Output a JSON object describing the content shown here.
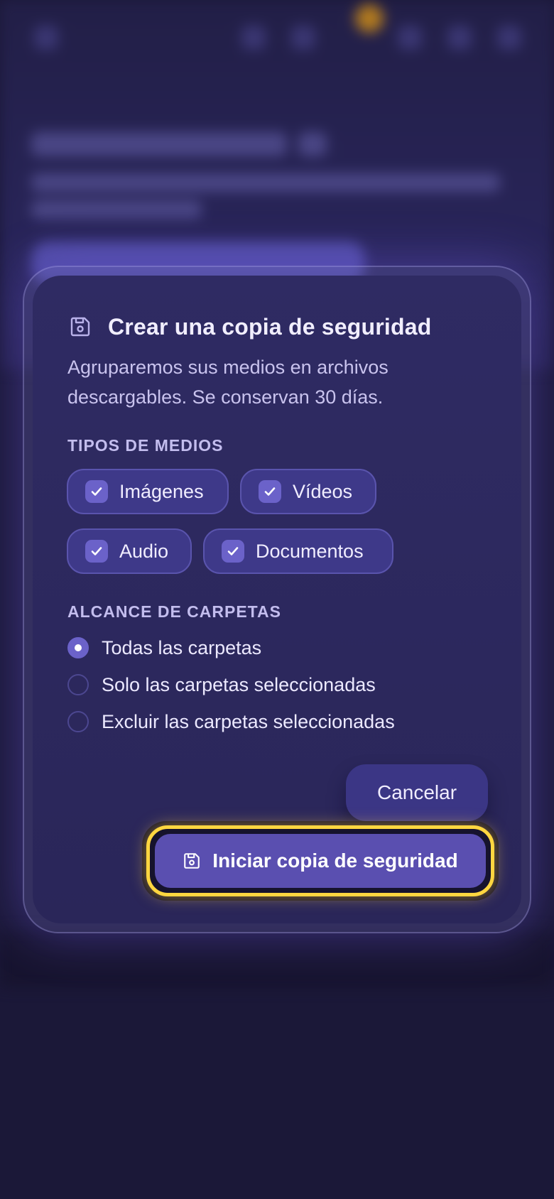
{
  "dialog": {
    "title": "Crear una copia de seguridad",
    "description": "Agruparemos sus medios en archivos descargables. Se conservan 30 días.",
    "media_types": {
      "label": "TIPOS DE MEDIOS",
      "items": [
        {
          "label": "Imágenes",
          "checked": true
        },
        {
          "label": "Vídeos",
          "checked": true
        },
        {
          "label": "Audio",
          "checked": true
        },
        {
          "label": "Documentos",
          "checked": true
        }
      ]
    },
    "folder_scope": {
      "label": "ALCANCE DE CARPETAS",
      "options": [
        {
          "label": "Todas las carpetas",
          "selected": true
        },
        {
          "label": "Solo las carpetas seleccionadas",
          "selected": false
        },
        {
          "label": "Excluir las carpetas seleccionadas",
          "selected": false
        }
      ]
    },
    "cancel_label": "Cancelar",
    "start_label": "Iniciar copia de seguridad"
  },
  "icons": {
    "title": "floppy-disk-icon",
    "start_button": "floppy-disk-icon",
    "chip_check": "check-icon"
  },
  "colors": {
    "accent": "#5a4fb0",
    "focus_ring": "#ffd640",
    "dialog_bg": "#2f2b63"
  }
}
